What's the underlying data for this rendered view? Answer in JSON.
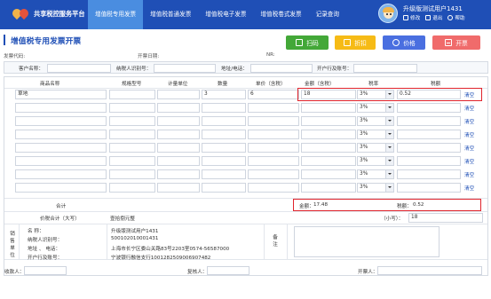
{
  "brand": {
    "name": "共享税控服务平台",
    "colors": [
      "#f0b34a",
      "#e5533d"
    ]
  },
  "nav": {
    "tabs": [
      "增值税专用发票",
      "增值税普通发票",
      "增值税电子发票",
      "增值税卷式发票",
      "记录查询"
    ],
    "active": 0
  },
  "user": {
    "name": "升级版测试用户1431",
    "actions": [
      "修改",
      "退出",
      "帮助"
    ]
  },
  "page": {
    "title": "增值税专用发票开票"
  },
  "toolbar": {
    "buttons": [
      {
        "label": "扫码",
        "color": "#43a838",
        "icon": "scan-icon"
      },
      {
        "label": "折扣",
        "color": "#f6bb16",
        "icon": "discount-icon"
      },
      {
        "label": "价格",
        "color": "#4a6fe0",
        "icon": "price-icon"
      },
      {
        "label": "开票",
        "color": "#f06b6b",
        "icon": "issue-icon"
      }
    ]
  },
  "meta": {
    "invoice_code_label": "发票代码:",
    "issue_date_label": "开票日期:",
    "number_label": "NR:"
  },
  "buyer": {
    "name_label": "客户名称：",
    "taxid_label": "纳税人识别号：",
    "addr_label": "地址/电话：",
    "bank_label": "开户行及账号："
  },
  "items": {
    "headers": [
      "商品名称",
      "规格型号",
      "计量单位",
      "数量",
      "单价（含税）",
      "金额（含税）",
      "税率",
      "税额"
    ],
    "rows": [
      {
        "name": "草地",
        "spec": "",
        "unit": "",
        "qty": "3",
        "price": "6",
        "amount": "18",
        "rate": "3%",
        "tax": "0.52"
      },
      {
        "name": "",
        "spec": "",
        "unit": "",
        "qty": "",
        "price": "",
        "amount": "",
        "rate": "3%",
        "tax": ""
      },
      {
        "name": "",
        "spec": "",
        "unit": "",
        "qty": "",
        "price": "",
        "amount": "",
        "rate": "3%",
        "tax": ""
      },
      {
        "name": "",
        "spec": "",
        "unit": "",
        "qty": "",
        "price": "",
        "amount": "",
        "rate": "3%",
        "tax": ""
      },
      {
        "name": "",
        "spec": "",
        "unit": "",
        "qty": "",
        "price": "",
        "amount": "",
        "rate": "3%",
        "tax": ""
      },
      {
        "name": "",
        "spec": "",
        "unit": "",
        "qty": "",
        "price": "",
        "amount": "",
        "rate": "3%",
        "tax": ""
      },
      {
        "name": "",
        "spec": "",
        "unit": "",
        "qty": "",
        "price": "",
        "amount": "",
        "rate": "3%",
        "tax": ""
      },
      {
        "name": "",
        "spec": "",
        "unit": "",
        "qty": "",
        "price": "",
        "amount": "",
        "rate": "3%",
        "tax": ""
      }
    ],
    "clear_label": "清空"
  },
  "totals": {
    "label": "合计",
    "amount_label": "金额：",
    "amount": "17.48",
    "tax_label": "税额：",
    "tax": "0.52"
  },
  "grand": {
    "label": "价税合计（大写）",
    "words": "壹拾捌元整",
    "small_label": "（小写）：",
    "small_value": "18"
  },
  "seller": {
    "section_label": "销售单位",
    "fields": [
      {
        "label": "名 称：",
        "value": "升级版测试用户1431"
      },
      {
        "label": "纳税人识别号：",
        "value": "500102010001431"
      },
      {
        "label": "地址 、 电话：",
        "value": "上海市长宁区娄山关路83号2203室0574-56587000"
      },
      {
        "label": "开户行及账号：",
        "value": "宁波银行融信支行1001282509006907482"
      }
    ],
    "remarks_label": "备注"
  },
  "footer": {
    "payee_label": "收款人：",
    "reviewer_label": "复核人：",
    "drawer_label": "开票人："
  }
}
